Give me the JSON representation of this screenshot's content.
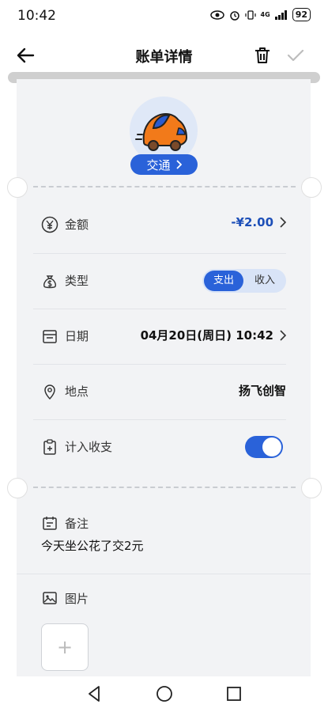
{
  "status": {
    "time": "10:42",
    "network": "4G",
    "battery": "92"
  },
  "header": {
    "title": "账单详情"
  },
  "category": {
    "label": "交通"
  },
  "rows": {
    "amount": {
      "label": "金额",
      "value": "-¥2.00"
    },
    "type": {
      "label": "类型",
      "expense": "支出",
      "income": "收入"
    },
    "date": {
      "label": "日期",
      "value": "04月20日(周日) 10:42"
    },
    "location": {
      "label": "地点",
      "value": "扬飞创智"
    },
    "include": {
      "label": "计入收支",
      "enabled": true
    }
  },
  "note": {
    "label": "备注",
    "text": "今天坐公花了交2元"
  },
  "image": {
    "label": "图片",
    "add_symbol": "+"
  },
  "colors": {
    "accent": "#2a62d9",
    "amount": "#1d4fb8",
    "paper": "#f2f3f5"
  }
}
